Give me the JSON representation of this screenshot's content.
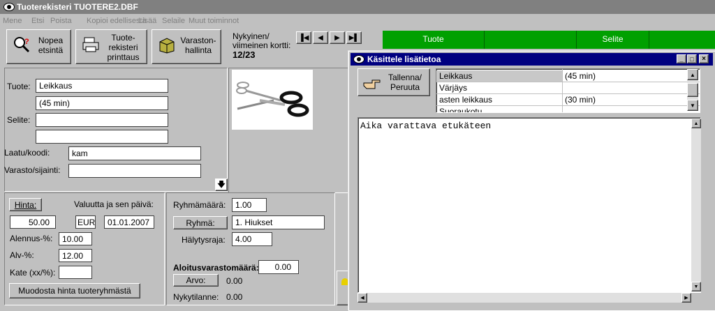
{
  "window": {
    "title": "Tuoterekisteri TUOTERE2.DBF"
  },
  "menu": [
    "Mene",
    "Etsi",
    "Poista",
    "Kopioi edellisestä",
    "Lisää",
    "Selaile",
    "Muut toiminnot"
  ],
  "toolbar": {
    "search_label1": "Nopea",
    "search_label2": "etsintä",
    "print_label1": "Tuote-",
    "print_label2": "rekisteri",
    "print_label3": "printtaus",
    "stock_label1": "Varaston-",
    "stock_label2": "hallinta"
  },
  "record": {
    "label1": "Nykyinen/",
    "label2": "viimeinen kortti:",
    "value": "12/23"
  },
  "grid_header": {
    "col1": "Tuote",
    "col2": "Selite"
  },
  "form": {
    "tuote_label": "Tuote:",
    "tuote_value": "Leikkaus",
    "tuote_value2": "(45 min)",
    "selite_label": "Selite:",
    "selite_value": "",
    "selite_value2": "",
    "laatu_label": "Laatu/koodi:",
    "laatu_value": "kam",
    "varasto_label": "Varasto/sijainti:",
    "varasto_value": ""
  },
  "price": {
    "hinta_button": "Hinta:",
    "valuutta_label": "Valuutta ja sen päivä:",
    "hinta_value": "50.00",
    "currency": "EUR",
    "date": "01.01.2007",
    "alennus_label": "Alennus-%:",
    "alennus_value": "10.00",
    "alv_label": "Alv-%:",
    "alv_value": "12.00",
    "kate_label": "Kate (xx/%):",
    "kate_value": "",
    "muodosta_button": "Muodosta hinta tuoteryhmästä"
  },
  "group": {
    "ryhmamaara_label": "Ryhmämäärä:",
    "ryhmamaara_value": "1.00",
    "ryhma_button": "Ryhmä:",
    "ryhma_value": "1. Hiukset",
    "halytysraja_label": "Hälytysraja:",
    "halytysraja_value": "4.00",
    "aloitus_label": "Aloitusvarastomäärä:",
    "aloitus_value": "0.00",
    "arvo_button": "Arvo:",
    "arvo_value": "0.00",
    "nykytilanne_label": "Nykytilanne:",
    "nykytilanne_value": "0.00"
  },
  "dialog": {
    "title": "Käsittele lisätietoa",
    "save_label1": "Tallenna/",
    "save_label2": "Peruuta",
    "rows": [
      {
        "name": "Leikkaus",
        "value": "(45 min)"
      },
      {
        "name": "Värjäys",
        "value": ""
      },
      {
        "name": " asten leikkaus",
        "value": "(30 min)"
      },
      {
        "name": "Suoraukotu",
        "value": ""
      }
    ],
    "text": "Aika varattava etukäteen"
  },
  "colors": {
    "accent_green": "#00a000",
    "dialog_title": "#000080"
  }
}
